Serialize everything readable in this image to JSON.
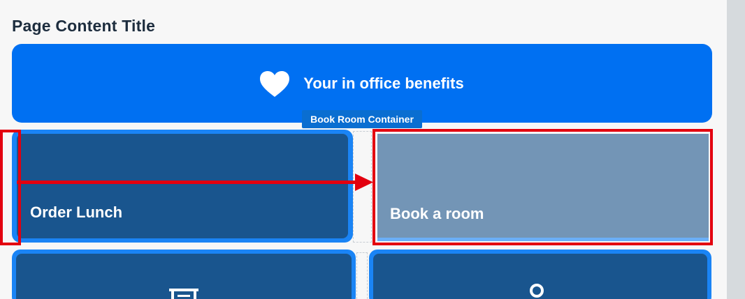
{
  "page": {
    "title": "Page Content Title"
  },
  "banner": {
    "text": "Your in office benefits",
    "icon": "heart-icon"
  },
  "container_tag": {
    "label": "Book Room Container"
  },
  "tiles": [
    {
      "label": "Order Lunch",
      "state": "normal"
    },
    {
      "label": "Book a room",
      "state": "dragging"
    },
    {
      "label": "",
      "icon": "inbox-tray-icon"
    },
    {
      "label": "",
      "icon": "person-icon"
    }
  ],
  "colors": {
    "background": "#f7f7f7",
    "banner": "#0070f2",
    "tile": "#19558e",
    "tile_border": "#1a84f5",
    "tile_dragging": "#7395b6",
    "annotation": "#e3000f",
    "tag": "#0a6ed1"
  }
}
